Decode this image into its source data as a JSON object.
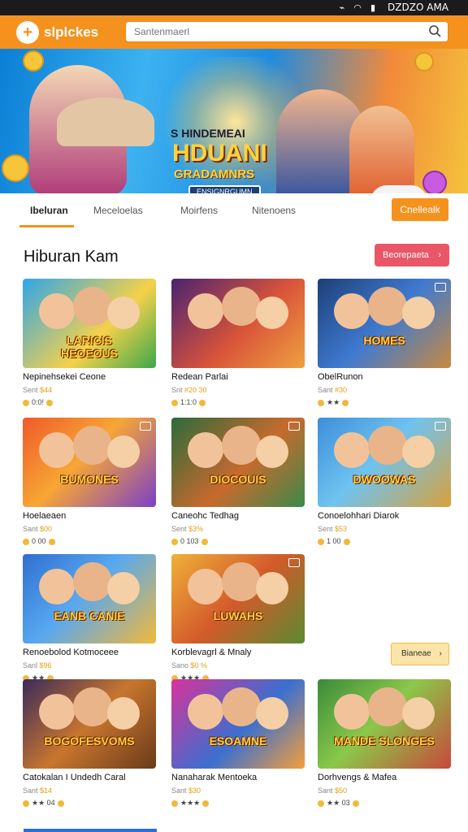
{
  "status": {
    "icons": "⌁ ◠ ▮",
    "time": "DZDZO AMA"
  },
  "header": {
    "logo_glyph": "+",
    "brand": "slplckes",
    "search_placeholder": "Santenmaerl"
  },
  "hero": {
    "line1": "S HINDEMEAI",
    "line2": "HDUANI",
    "line3": "GRADAMNRS",
    "line4": "ENSIGNRGUMN"
  },
  "tabs": [
    {
      "label": "Ibeluran"
    },
    {
      "label": "Meceloelas"
    },
    {
      "label": "Moirfens"
    },
    {
      "label": "Nitenoens"
    }
  ],
  "tab_button": "Cnellealk",
  "section": {
    "title": "Hiburan Kam",
    "button": "Beorepaeta",
    "chevron": "›"
  },
  "more_button": {
    "label": "Bianeae",
    "chevron": "›"
  },
  "cards": [
    {
      "title": "Nepinehsekei Ceone",
      "meta_prefix": "Sent",
      "meta_price": "$44",
      "rating": "0:0!",
      "icon": "",
      "banner": "LARICIS HEOEOUS"
    },
    {
      "title": "Redean Parlai",
      "meta_prefix": "Snt",
      "meta_price": "#20 30",
      "rating": "1:1:0",
      "icon": "",
      "banner": ""
    },
    {
      "title": "ObelRunon",
      "meta_prefix": "Sant",
      "meta_price": "#30",
      "rating": "★★",
      "icon": "screen-icon",
      "banner": "HOMES"
    },
    {
      "title": "Hoelaeaen",
      "meta_prefix": "Sant",
      "meta_price": "$00",
      "rating": "0 00",
      "icon": "screen-icon",
      "banner": "BUMONES"
    },
    {
      "title": "Caneohc Tedhag",
      "meta_prefix": "Sent",
      "meta_price": "$3%",
      "rating": "0 103",
      "icon": "screen-icon",
      "banner": "DIOCOUIS"
    },
    {
      "title": "Conoelohhari Diarok",
      "meta_prefix": "Sent",
      "meta_price": "$53",
      "rating": "1 00",
      "icon": "screen-icon",
      "banner": "DWOOWAS"
    },
    {
      "title": "Renoebolod Kotmoceee",
      "meta_prefix": "Sanl",
      "meta_price": "$96",
      "rating": "★★",
      "icon": "",
      "banner": "EANB CANIE"
    },
    {
      "title": "Korblevagrl & Mnaly",
      "meta_prefix": "Sano",
      "meta_price": "$0 %",
      "rating": "★★★",
      "icon": "screen-icon",
      "banner": "LUWAHS"
    },
    {
      "title": "Catokalan I Undedh Caral",
      "meta_prefix": "Sant",
      "meta_price": "$14",
      "rating": "★★ 04",
      "icon": "",
      "banner": "BOGOFESVOMS"
    },
    {
      "title": "Nanaharak Mentoeka",
      "meta_prefix": "Sant",
      "meta_price": "$30",
      "rating": "★★★",
      "icon": "",
      "banner": "ESOAMNE"
    },
    {
      "title": "Dorhvengs & Mafea",
      "meta_prefix": "Sant",
      "meta_price": "$50",
      "rating": "★★ 03",
      "icon": "",
      "banner": "MANDE SLONGES"
    }
  ],
  "colors": {
    "accent": "#f5921e",
    "section_button": "#e95668",
    "more_button_bg": "#fbe4a8"
  }
}
